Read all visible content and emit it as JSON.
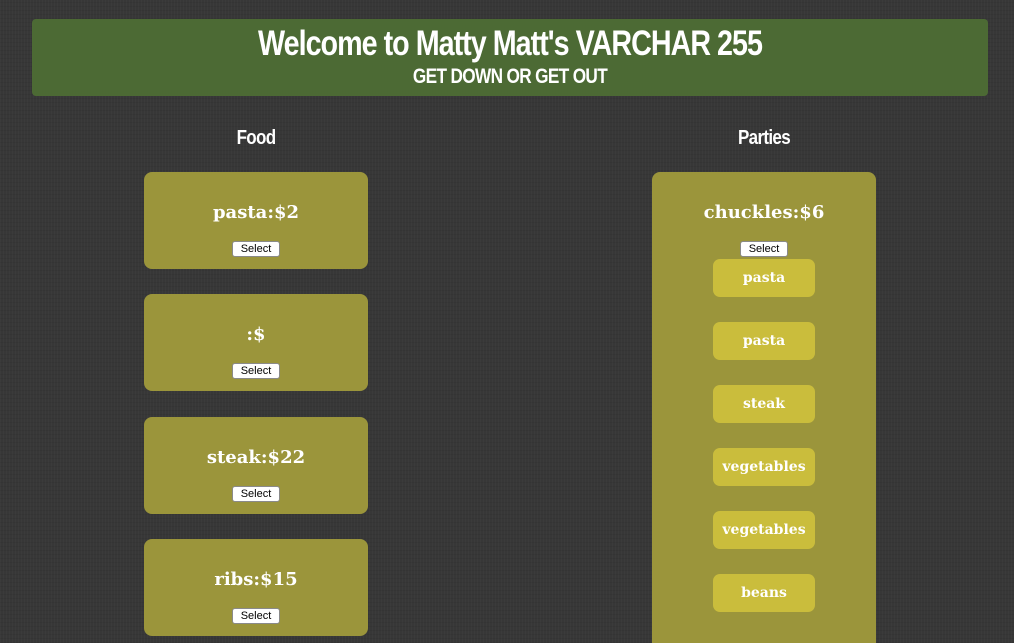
{
  "header": {
    "title": "Welcome to Matty Matt's VARCHAR 255",
    "subtitle": "GET DOWN OR GET OUT"
  },
  "food": {
    "title": "Food",
    "items": [
      {
        "label": "pasta:$2",
        "button": "Select"
      },
      {
        "label": ":$",
        "button": "Select"
      },
      {
        "label": "steak:$22",
        "button": "Select"
      },
      {
        "label": "ribs:$15",
        "button": "Select"
      }
    ]
  },
  "parties": {
    "title": "Parties",
    "items": [
      {
        "label": "chuckles:$6",
        "button": "Select",
        "foods": [
          "pasta",
          "pasta",
          "steak",
          "vegetables",
          "vegetables",
          "beans"
        ]
      }
    ]
  },
  "colors": {
    "header_bg": "#4c6a34",
    "card_bg": "#9b953b",
    "pill_bg": "#cabd3c",
    "page_bg": "#373737"
  }
}
